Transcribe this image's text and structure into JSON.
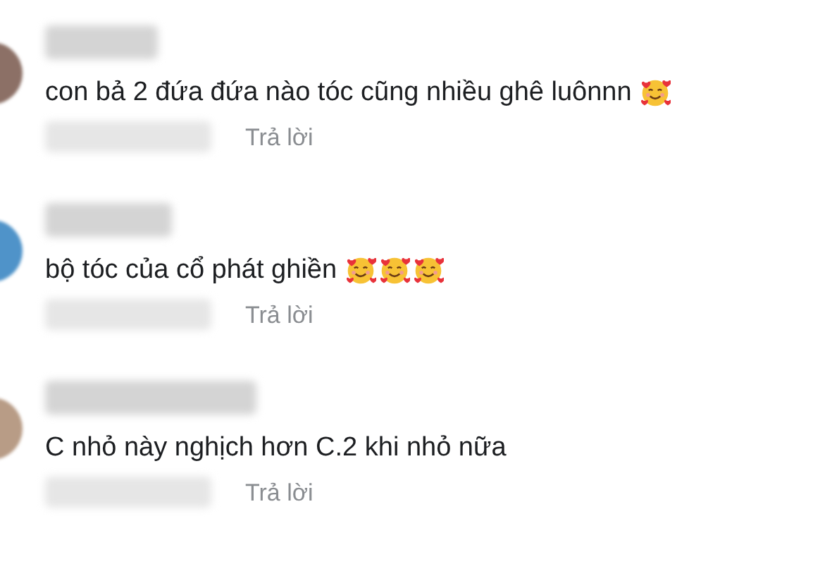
{
  "comments": [
    {
      "text": "con bả 2 đứa đứa nào tóc cũng nhiều ghê luônnn",
      "emojis": [
        {
          "kind": "smiling-face-with-hearts"
        }
      ],
      "reply": "Trả lời"
    },
    {
      "text": "bộ tóc của cổ phát ghiền",
      "emojis": [
        {
          "kind": "smiling-face-with-hearts"
        },
        {
          "kind": "smiling-face-with-hearts"
        },
        {
          "kind": "smiling-face-with-hearts"
        }
      ],
      "reply": "Trả lời"
    },
    {
      "text": "C nhỏ này nghịch hơn C.2 khi nhỏ nữa",
      "reply": "Trả lời"
    }
  ]
}
